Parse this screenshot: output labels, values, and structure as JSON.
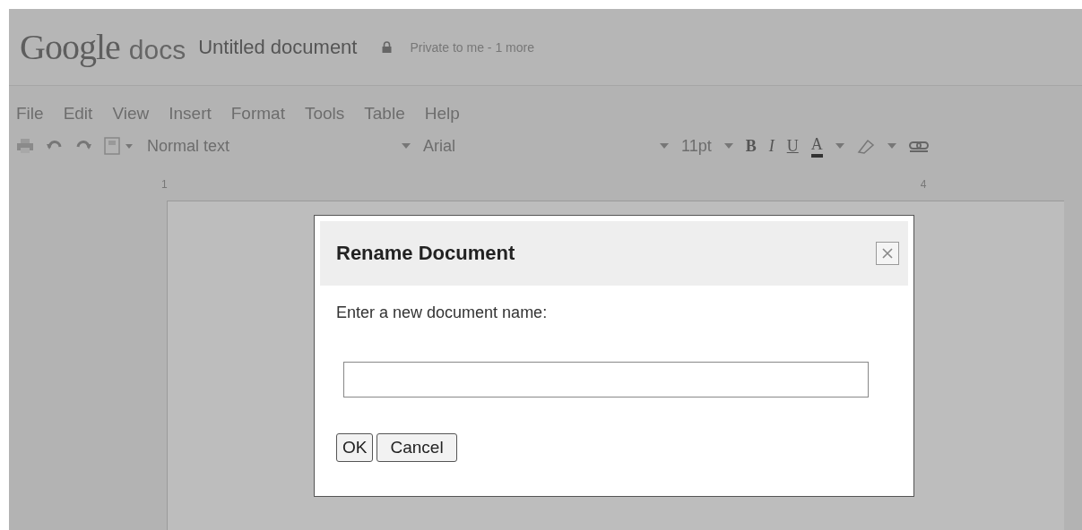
{
  "header": {
    "logo_word": "Google",
    "logo_product": "docs",
    "doc_title": "Untitled document",
    "sharing": "Private to me - 1 more"
  },
  "menu": [
    "File",
    "Edit",
    "View",
    "Insert",
    "Format",
    "Tools",
    "Table",
    "Help"
  ],
  "toolbar": {
    "style": "Normal text",
    "font": "Arial",
    "size": "11pt",
    "bold": "B",
    "italic": "I",
    "underline": "U",
    "text_color": "A"
  },
  "ruler": [
    "1",
    "4"
  ],
  "dialog": {
    "title": "Rename Document",
    "prompt": "Enter a new document name:",
    "buttons": [
      "OK",
      "Cancel"
    ]
  }
}
